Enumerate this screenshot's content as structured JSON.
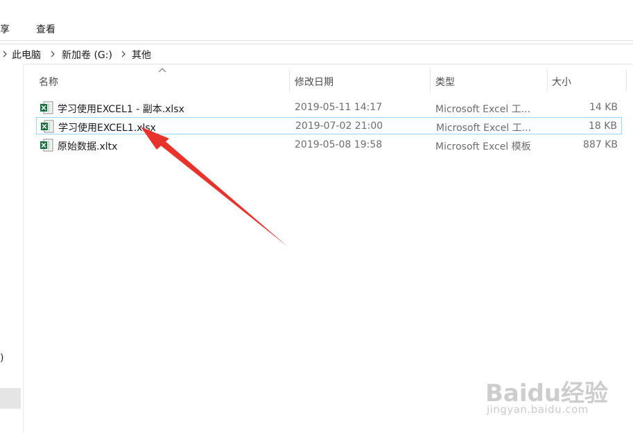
{
  "ribbon": {
    "tabs": [
      "享",
      "查看"
    ]
  },
  "address": {
    "crumbs": [
      "此电脑",
      "新加卷 (G:)",
      "其他"
    ]
  },
  "nav": {
    "fragment": ")"
  },
  "columns": {
    "name": "名称",
    "date": "修改日期",
    "type": "类型",
    "size": "大小"
  },
  "files": [
    {
      "name": "学习使用EXCEL1 - 副本.xlsx",
      "date": "2019-05-11 14:17",
      "type": "Microsoft Excel 工...",
      "size": "14 KB",
      "selected": false
    },
    {
      "name": "学习使用EXCEL1.xlsx",
      "date": "2019-07-02 21:00",
      "type": "Microsoft Excel 工...",
      "size": "18 KB",
      "selected": true
    },
    {
      "name": "原始数据.xltx",
      "date": "2019-05-08 19:58",
      "type": "Microsoft Excel 模板",
      "size": "887 KB",
      "selected": false
    }
  ],
  "colors": {
    "arrow": "#e8322c",
    "excel_green": "#1d7044",
    "selection_border": "#99d1ff"
  },
  "watermark": {
    "logo": "Baidu经验",
    "url": "jingyan.baidu.com"
  }
}
